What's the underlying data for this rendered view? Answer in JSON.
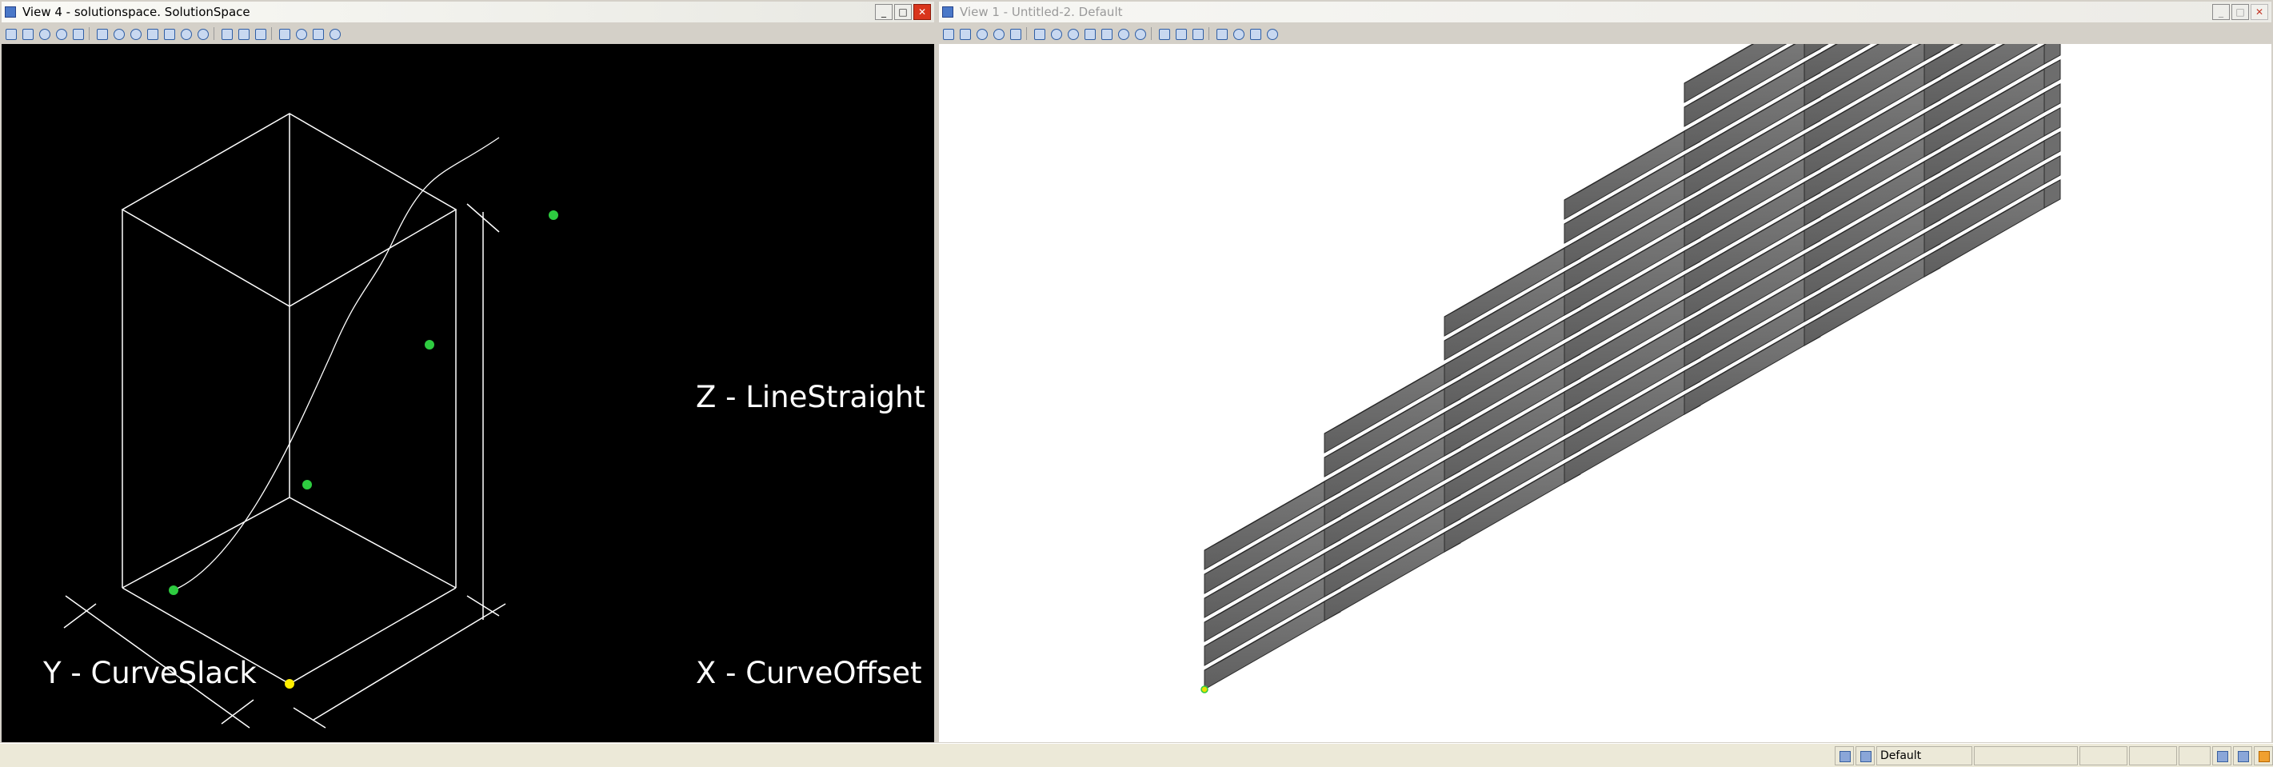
{
  "left_view": {
    "title": "View 4 - solutionspace. SolutionSpace",
    "labels": {
      "z_axis": "Z - LineStraight",
      "y_axis": "Y - CurveSlack",
      "x_axis": "X - CurveOffset"
    },
    "colors": {
      "background": "#000000",
      "wireframe": "#ffffff",
      "control_point": "#2ecc40",
      "origin_point": "#ffee00"
    }
  },
  "right_view": {
    "title": "View 1 - Untitled-2. Default",
    "colors": {
      "background": "#ffffff",
      "model": "#8c8c8c"
    }
  },
  "window_buttons": {
    "minimize": "_",
    "maximize": "□",
    "close": "✕"
  },
  "toolbar_icons": [
    "select-icon",
    "dropdown-icon",
    "orbit-icon",
    "pan-icon",
    "dropdown-icon",
    "zoom-icon",
    "zoom-in-icon",
    "zoom-out-icon",
    "zoom-window-icon",
    "zoom-extents-icon",
    "undo-view-icon",
    "redo-view-icon",
    "walk-icon",
    "camera-icon",
    "grid-icon",
    "display-icon",
    "filter-icon",
    "measure-icon",
    "settings-icon"
  ],
  "status_bar": {
    "style_value": "Default"
  }
}
